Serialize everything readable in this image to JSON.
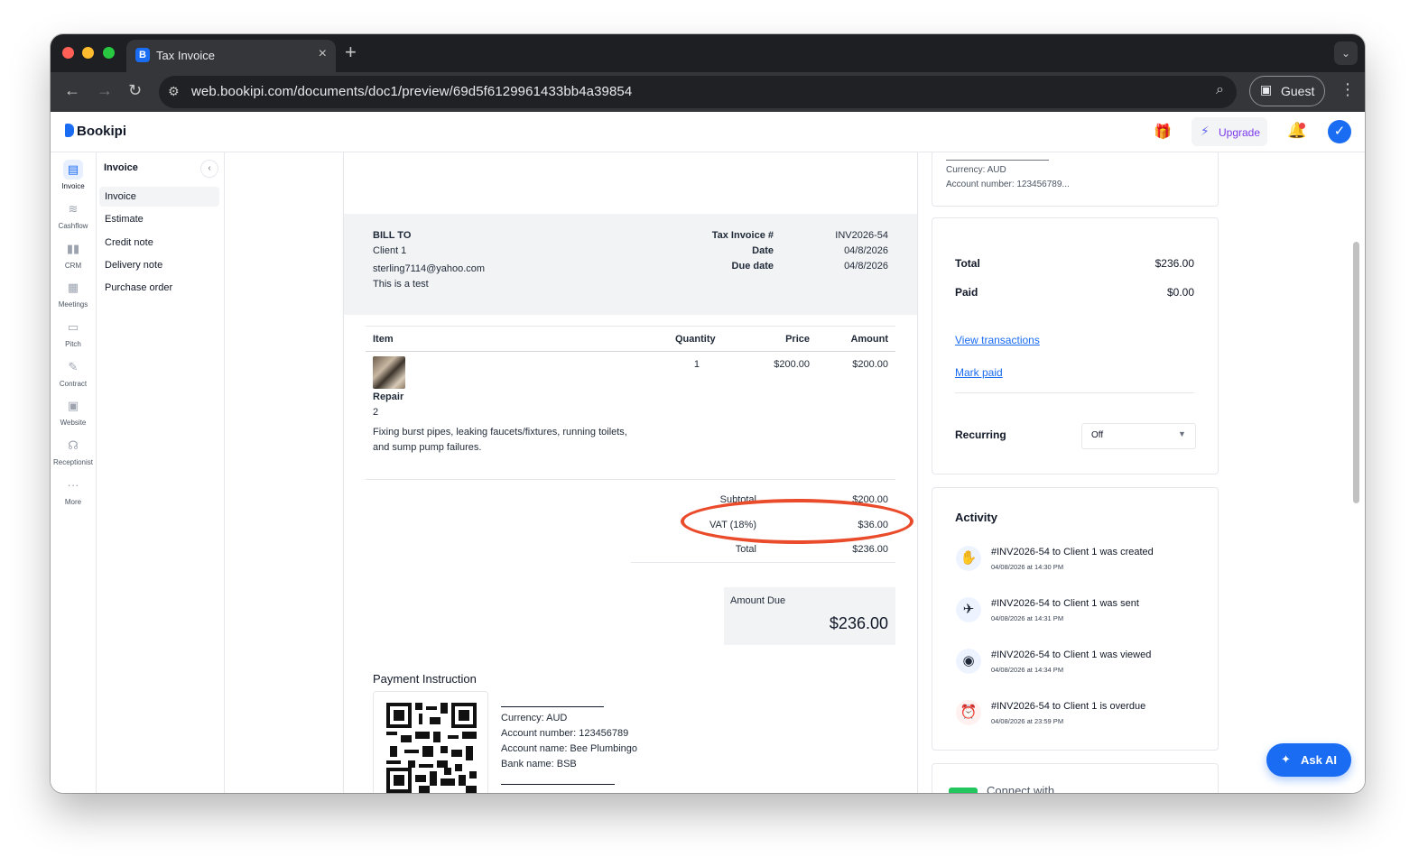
{
  "browser": {
    "tab_title": "Tax Invoice",
    "tab_favicon": "B",
    "url": "web.bookipi.com/documents/doc1/preview/69d5f6129961433bb4a39854",
    "profile_label": "Guest"
  },
  "app": {
    "brand": "Bookipi",
    "upgrade_label": "Upgrade",
    "ask_ai_label": "Ask AI",
    "accent_color": "#1a6cf2"
  },
  "rail": [
    {
      "label": "Invoice",
      "icon": "invoice-icon",
      "active": true
    },
    {
      "label": "Cashflow",
      "icon": "cashflow-icon"
    },
    {
      "label": "CRM",
      "icon": "crm-icon"
    },
    {
      "label": "Meetings",
      "icon": "calendar-icon"
    },
    {
      "label": "Pitch",
      "icon": "presentation-icon"
    },
    {
      "label": "Contract",
      "icon": "pen-icon"
    },
    {
      "label": "Website",
      "icon": "layout-icon"
    },
    {
      "label": "Receptionist",
      "icon": "headset-icon"
    },
    {
      "label": "More",
      "icon": "more-dots-icon"
    }
  ],
  "sidenav": {
    "title": "Invoice",
    "items": [
      "Invoice",
      "Estimate",
      "Credit note",
      "Delivery note",
      "Purchase order"
    ]
  },
  "invoice": {
    "bill_to_label": "BILL TO",
    "client_name": "Client 1",
    "client_email": "sterling7114@yahoo.com",
    "client_note": "This is a test",
    "number_label": "Tax Invoice #",
    "number": "INV2026-54",
    "date_label": "Date",
    "date": "04/8/2026",
    "due_label": "Due date",
    "due": "04/8/2026",
    "columns": {
      "item": "Item",
      "quantity": "Quantity",
      "price": "Price",
      "amount": "Amount"
    },
    "line": {
      "name": "Repair",
      "code": "2",
      "desc1": "Fixing burst pipes, leaking faucets/fixtures, running toilets,",
      "desc2": "and sump pump failures.",
      "quantity": "1",
      "price": "$200.00",
      "amount": "$200.00"
    },
    "subtotal_label": "Subtotal",
    "subtotal": "$200.00",
    "vat_label": "VAT (18%)",
    "vat": "$36.00",
    "total_label": "Total",
    "total": "$236.00",
    "amount_due_label": "Amount Due",
    "amount_due": "$236.00",
    "annotation_color": "#ea4b2b",
    "payment_heading": "Payment Instruction",
    "payment_lines": [
      "Currency: AUD",
      "Account number: 123456789",
      "Account name: Bee Plumbingo",
      "Bank name: BSB"
    ]
  },
  "side_panel": {
    "top_card": [
      "Currency: AUD",
      "Account number: 123456789..."
    ],
    "total_label": "Total",
    "total": "$236.00",
    "paid_label": "Paid",
    "paid": "$0.00",
    "view_transactions": "View transactions",
    "mark_paid": "Mark paid",
    "recurring_label": "Recurring",
    "recurring_value": "Off",
    "activity_title": "Activity",
    "activity": [
      {
        "text": "#INV2026-54 to Client 1 was created",
        "time": "04/08/2026 at 14:30 PM",
        "icon": "hand-icon"
      },
      {
        "text": "#INV2026-54 to Client 1 was sent",
        "time": "04/08/2026 at 14:31 PM",
        "icon": "paper-plane-icon"
      },
      {
        "text": "#INV2026-54 to Client 1 was viewed",
        "time": "04/08/2026 at 14:34 PM",
        "icon": "eye-icon"
      },
      {
        "text": "#INV2026-54 to Client 1 is overdue",
        "time": "04/08/2026 at 23:59 PM",
        "icon": "alarm-clock-icon"
      }
    ],
    "connect_label": "Connect with"
  }
}
